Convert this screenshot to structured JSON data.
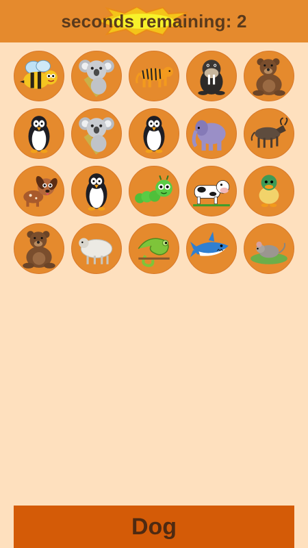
{
  "header": {
    "timer_text": "seconds remaining: 2"
  },
  "tiles": [
    {
      "animal": "bee-icon"
    },
    {
      "animal": "koala-icon"
    },
    {
      "animal": "tiger-icon"
    },
    {
      "animal": "walrus-icon"
    },
    {
      "animal": "bear-icon"
    },
    {
      "animal": "penguin-icon"
    },
    {
      "animal": "koala-icon"
    },
    {
      "animal": "penguin-icon"
    },
    {
      "animal": "elephant-icon"
    },
    {
      "animal": "wildebeest-icon"
    },
    {
      "animal": "dog-icon"
    },
    {
      "animal": "penguin-icon"
    },
    {
      "animal": "caterpillar-icon"
    },
    {
      "animal": "cow-icon"
    },
    {
      "animal": "duck-icon"
    },
    {
      "animal": "bear-icon"
    },
    {
      "animal": "sheep-icon"
    },
    {
      "animal": "chameleon-icon"
    },
    {
      "animal": "shark-icon"
    },
    {
      "animal": "mouse-icon"
    }
  ],
  "answer": {
    "label": "Dog"
  },
  "colors": {
    "background": "#fee0be",
    "header": "#e58a2d",
    "tile": "#e58a2d",
    "answer_bar": "#d45b07",
    "text_dark": "#5a3a1c"
  }
}
